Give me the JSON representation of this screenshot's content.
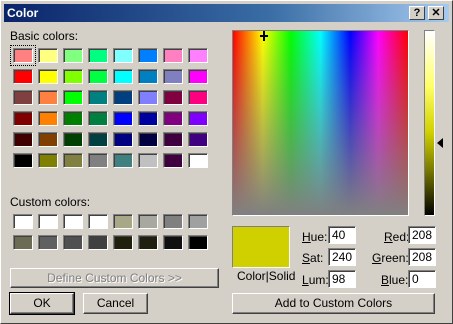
{
  "window": {
    "title": "Color"
  },
  "titlebar_buttons": {
    "help": "?",
    "close": "✕"
  },
  "basic_colors": {
    "label": "Basic colors:",
    "rows": [
      [
        "#ff8080",
        "#ffff80",
        "#80ff80",
        "#00ff80",
        "#80ffff",
        "#0080ff",
        "#ff80c0",
        "#ff80ff"
      ],
      [
        "#ff0000",
        "#ffff00",
        "#80ff00",
        "#00ff40",
        "#00ffff",
        "#0080c0",
        "#8080c0",
        "#ff00ff"
      ],
      [
        "#804040",
        "#ff8040",
        "#00ff00",
        "#008080",
        "#004080",
        "#8080ff",
        "#800040",
        "#ff0080"
      ],
      [
        "#800000",
        "#ff8000",
        "#008000",
        "#008040",
        "#0000ff",
        "#0000a0",
        "#800080",
        "#8000ff"
      ],
      [
        "#400000",
        "#804000",
        "#004000",
        "#004040",
        "#000080",
        "#000040",
        "#400040",
        "#400080"
      ],
      [
        "#000000",
        "#808000",
        "#808040",
        "#808080",
        "#408080",
        "#c0c0c0",
        "#400040",
        "#ffffff"
      ]
    ],
    "selected": [
      0,
      0
    ]
  },
  "custom_colors": {
    "label": "Custom colors:",
    "rows": [
      [
        "#ffffff",
        "#ffffff",
        "#ffffff",
        "#ffffff",
        "#a8a888",
        "#a8a8a0",
        "#808080",
        "#a0a0a0"
      ],
      [
        "#6c6c54",
        "#606060",
        "#505050",
        "#404040",
        "#20200c",
        "#202010",
        "#101010",
        "#000000"
      ]
    ]
  },
  "buttons": {
    "define": "Define Custom Colors >>",
    "ok": "OK",
    "cancel": "Cancel",
    "add": "Add to Custom Colors"
  },
  "current_color": "#d0d000",
  "color_solid_label": "Color|Solid",
  "fields": {
    "hue": {
      "label": "Hue:",
      "value": "40"
    },
    "sat": {
      "label": "Sat:",
      "value": "240"
    },
    "lum": {
      "label": "Lum:",
      "value": "98"
    },
    "red": {
      "label": "Red:",
      "value": "208"
    },
    "green": {
      "label": "Green:",
      "value": "208"
    },
    "blue": {
      "label": "Blue:",
      "value": "0"
    }
  }
}
